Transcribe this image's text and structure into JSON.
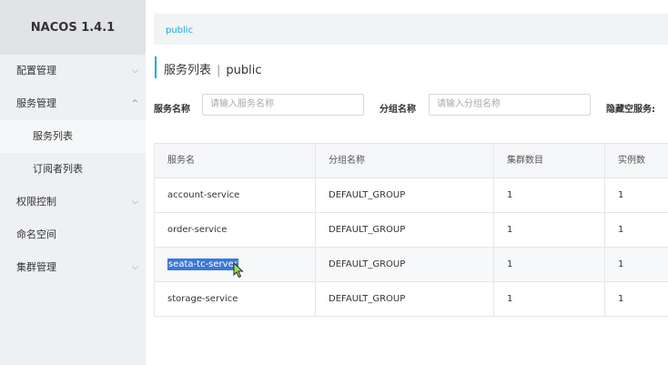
{
  "brand": "NACOS 1.4.1",
  "sidebar": {
    "items": [
      {
        "label": "配置管理",
        "chevron": "⌵"
      },
      {
        "label": "服务管理",
        "chevron": "^"
      },
      {
        "label": "服务列表"
      },
      {
        "label": "订阅者列表"
      },
      {
        "label": "权限控制",
        "chevron": "⌵"
      },
      {
        "label": "命名空间"
      },
      {
        "label": "集群管理",
        "chevron": "⌵"
      }
    ]
  },
  "topbar": {
    "namespace": "public"
  },
  "page": {
    "title": "服务列表",
    "separator": "|",
    "namespace": "public"
  },
  "filters": {
    "service_name_label": "服务名称",
    "service_name_placeholder": "请输入服务名称",
    "group_label": "分组名称",
    "group_placeholder": "请输入分组名称",
    "hide_empty_label": "隐藏空服务:"
  },
  "table": {
    "headers": [
      "服务名",
      "分组名称",
      "集群数目",
      "实例数"
    ],
    "rows": [
      [
        "account-service",
        "DEFAULT_GROUP",
        "1",
        "1"
      ],
      [
        "order-service",
        "DEFAULT_GROUP",
        "1",
        "1"
      ],
      [
        "seata-tc-server",
        "DEFAULT_GROUP",
        "1",
        "1"
      ],
      [
        "storage-service",
        "DEFAULT_GROUP",
        "1",
        "1"
      ]
    ]
  },
  "colors": {
    "accent": "#1aa8d8",
    "selection": "#3b78d6",
    "sidebar_bg": "#eef0f3"
  }
}
